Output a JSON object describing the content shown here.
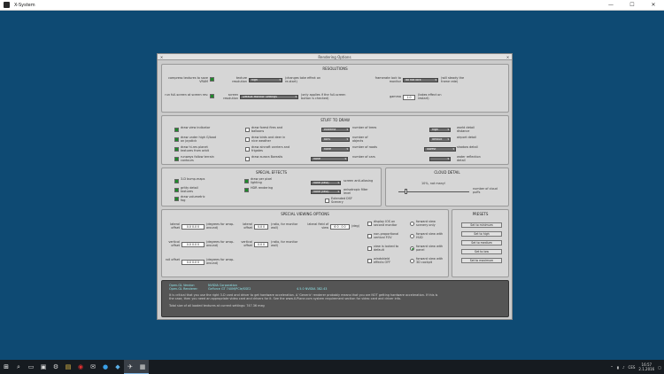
{
  "window": {
    "title": "X-System",
    "minimize": "—",
    "maximize": "☐",
    "close": "✕"
  },
  "dialog": {
    "title": "Rendering Options"
  },
  "resolutions": {
    "title": "RESOLUTIONS",
    "compress_label": "compress textures to save VRAM",
    "texture_res_label": "texture resolution",
    "texture_res_value": "high",
    "texture_res_note": "(changes take effect on re-start)",
    "framerate_label": "framerate lock to monitor",
    "framerate_value": "do not lock",
    "framerate_note": "(will steady the frame rate)",
    "fullscreen_label": "run full-screen at screen res:",
    "screen_res_label": "screen resolution",
    "screen_res_value": "Default Monitor Settings",
    "screen_res_note": "(only applies if the full-screen button is checked)",
    "gamma_label": "gamma",
    "gamma_value": "1.0",
    "gamma_note": "(takes effect on restart)"
  },
  "stuff": {
    "title": "STUFF TO DRAW",
    "col1": [
      "draw view indicator",
      "draw under high G/load on joystick",
      "draw hi-res planet textures from orbit",
      "runways follow terrain contours"
    ],
    "col2": [
      "draw forest fires and balloons",
      "draw birds and deer in nice weather",
      "draw aircraft carriers and frigates",
      "draw aurora Borealis"
    ],
    "col3_values": [
      "extreme",
      "tons",
      "none",
      "none"
    ],
    "col3_labels": [
      "number of trees",
      "number of objects",
      "number of roads",
      "number of cars"
    ],
    "col4_values": [
      "high",
      "default",
      "lowest",
      ""
    ],
    "col4_labels": [
      "world detail distance",
      "airport detail",
      "shadow detail",
      "water reflection detail"
    ]
  },
  "effects": {
    "title": "SPECIAL EFFECTS",
    "col1": [
      "3-D bump-maps",
      "gritty detail textures",
      "draw volumetric fog"
    ],
    "col2": [
      "draw per pixel lighting",
      "HDR rendering"
    ],
    "anisotropic_value": "none (fast)",
    "anisotropic_label": "screen anti-aliasing",
    "filter_value": "none (fast)",
    "filter_label": "anisotropic filter level",
    "extended_dsf": "Extended DSF Scenery"
  },
  "cloud": {
    "title": "CLOUD DETAIL",
    "value": "10%, not many!",
    "label": "number of cloud puffs"
  },
  "viewing": {
    "title": "SPECIAL VIEWING OPTIONS",
    "spin_values": [
      "0.0 0.0 0",
      "0.0 0",
      "0.0 0",
      "0.0 0",
      "0.0 0.0 0",
      "0.0 0",
      "0.0 0.0 0"
    ],
    "lateral_label": "lateral offset",
    "lateral_unit": "(degrees for wrap-around)",
    "vertical_label": "vertical offset",
    "vertical_unit": "(degrees for wrap-around)",
    "roll_label": "roll offset",
    "roll_unit": "(degrees for wrap-around)",
    "lat_ratio_label": "lateral offset",
    "lat_ratio_unit": "(ratio, for monitor wall)",
    "vert_ratio_label": "vertical offset",
    "vert_ratio_unit": "(ratio, for monitor wall)",
    "fov_label": "lateral field of view",
    "fov_unit": "(deg)",
    "fov_value": "6 0 . 0 0",
    "checks": [
      "display IOS on second monitor",
      "non-proportional vertical FOV",
      "view is locked to default",
      "windshield effects OFF"
    ],
    "radios": [
      "forward view scenery only",
      "forward view with HUD",
      "forward view with panel",
      "forward view with 3D cockpit"
    ]
  },
  "presets": {
    "title": "PRESETS",
    "buttons": [
      "Set to minimum",
      "Set to high",
      "Set to medium",
      "Set to low",
      "Set to maximum"
    ]
  },
  "info": {
    "vendor_label": "Open-GL Vendor:",
    "vendor_value": "NVIDIA Corporation",
    "renderer_label": "Open-GL Renderer:",
    "renderer_value": "GeForce GT 740M/PCIe/SSE2",
    "version_value": "4.5.0 NVIDIA 382.43",
    "msg1": "It is critical that you use the right 3-D card and driver to get hardware acceleration. A 'Generic' renderer probably means that you are NOT getting hardware acceleration. If this is",
    "msg2": "the case, then you need an appropriate video card and drivers for it. See the www.X-Plane.com system requirement section for video card and driver info.",
    "total": "Total size of all loaded textures at current settings: 747.36 meg"
  },
  "taskbar": {
    "lang": "CES",
    "time": "16:57",
    "date": "2.1.2016"
  }
}
